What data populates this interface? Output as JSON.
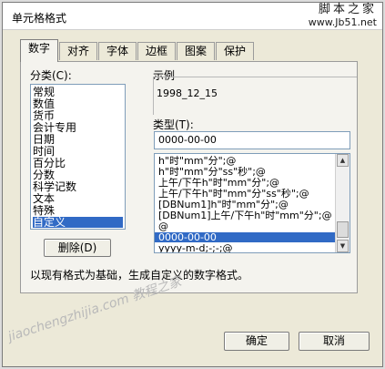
{
  "window": {
    "title": "单元格格式",
    "watermark_line1": "脚本之家",
    "watermark_line2": "www.Jb51.net",
    "bottom_watermark": "jiaochengzhijia.com 教程之家"
  },
  "tabs": [
    {
      "label": "数字",
      "active": true
    },
    {
      "label": "对齐",
      "active": false
    },
    {
      "label": "字体",
      "active": false
    },
    {
      "label": "边框",
      "active": false
    },
    {
      "label": "图案",
      "active": false
    },
    {
      "label": "保护",
      "active": false
    }
  ],
  "category": {
    "label": "分类(C):",
    "items": [
      "常规",
      "数值",
      "货币",
      "会计专用",
      "日期",
      "时间",
      "百分比",
      "分数",
      "科学记数",
      "文本",
      "特殊",
      "自定义"
    ],
    "selected": "自定义"
  },
  "sample": {
    "label": "示例",
    "value": "1998_12_15"
  },
  "type": {
    "label": "类型(T):",
    "value": "0000-00-00"
  },
  "formats": {
    "items": [
      "h\"时\"mm\"分\";@",
      "h\"时\"mm\"分\"ss\"秒\";@",
      "上午/下午h\"时\"mm\"分\";@",
      "上午/下午h\"时\"mm\"分\"ss\"秒\";@",
      "[DBNum1]h\"时\"mm\"分\";@",
      "[DBNum1]上午/下午h\"时\"mm\"分\";@",
      "@",
      "0000-00-00",
      "yyyy-m-d;-;-;@"
    ],
    "selected": "0000-00-00"
  },
  "buttons": {
    "delete": "删除(D)",
    "ok": "确定",
    "cancel": "取消"
  },
  "description": "以现有格式为基础，生成自定义的数字格式。",
  "colors": {
    "selection": "#316ac5",
    "dialog_bg": "#ece9d8"
  }
}
